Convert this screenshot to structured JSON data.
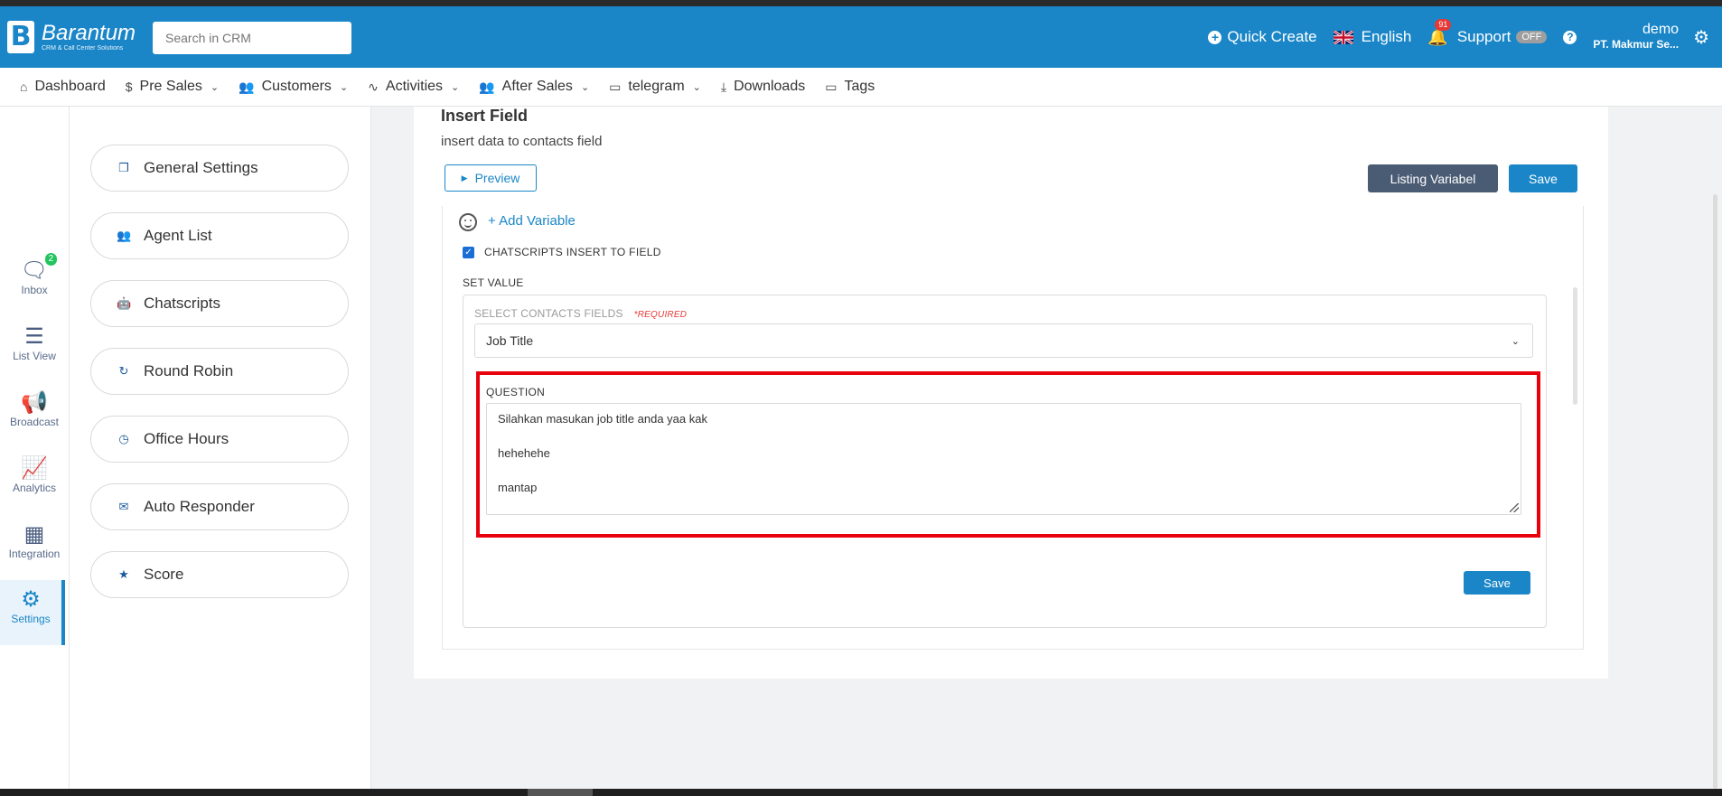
{
  "header": {
    "logo_name": "Barantum",
    "logo_sub": "CRM & Call Center Solutions",
    "search_placeholder": "Search in CRM",
    "quick_create": "Quick Create",
    "language": "English",
    "notifications_count": "91",
    "support": "Support",
    "support_toggle": "OFF",
    "user_name": "demo",
    "company": "PT. Makmur Se..."
  },
  "nav": {
    "items": [
      {
        "label": "Dashboard",
        "icon": "home-icon"
      },
      {
        "label": "Pre Sales",
        "icon": "dollar-icon"
      },
      {
        "label": "Customers",
        "icon": "users-icon"
      },
      {
        "label": "Activities",
        "icon": "activity-icon"
      },
      {
        "label": "After Sales",
        "icon": "users-icon"
      },
      {
        "label": "telegram",
        "icon": "folder-icon"
      },
      {
        "label": "Downloads",
        "icon": "download-icon"
      },
      {
        "label": "Tags",
        "icon": "folder-icon"
      }
    ]
  },
  "leftbar": {
    "items": [
      {
        "label": "Inbox",
        "badge": "2"
      },
      {
        "label": "List View"
      },
      {
        "label": "Broadcast"
      },
      {
        "label": "Analytics"
      },
      {
        "label": "Integration"
      },
      {
        "label": "Settings",
        "active": true
      }
    ]
  },
  "settings_menu": {
    "items": [
      {
        "label": "General Settings"
      },
      {
        "label": "Agent List"
      },
      {
        "label": "Chatscripts"
      },
      {
        "label": "Round Robin"
      },
      {
        "label": "Office Hours"
      },
      {
        "label": "Auto Responder"
      },
      {
        "label": "Score"
      }
    ]
  },
  "main": {
    "title": "Insert Field",
    "subtitle": "insert data to contacts field",
    "preview_label": "Preview",
    "listing_label": "Listing Variabel",
    "save_label": "Save",
    "add_variable": "+ Add Variable",
    "checkbox_label": "CHATSCRIPTS INSERT TO FIELD",
    "set_value": "SET VALUE",
    "select_label": "SELECT CONTACTS FIELDS",
    "required": "*REQUIRED",
    "select_value": "Job Title",
    "question_label": "QUESTION",
    "question_lines": [
      "Silahkan masukan job title anda yaa kak",
      "hehehehe",
      "mantap"
    ],
    "bottom_save": "Save"
  },
  "colors": {
    "primary": "#1a86c8",
    "highlight": "#e8000d",
    "dark_button": "#4a5c74"
  }
}
